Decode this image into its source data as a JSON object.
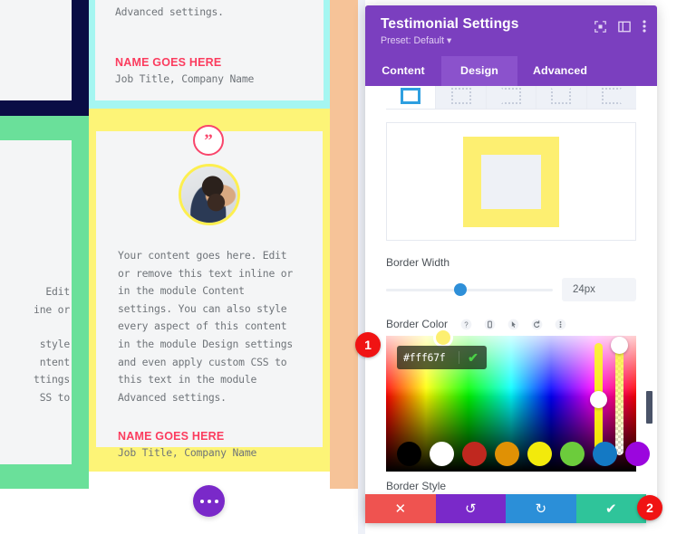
{
  "canvas": {
    "top_card": {
      "body_tail": "Advanced settings.",
      "name": "NAME GOES HERE",
      "job": "Job Title, Company Name"
    },
    "main_card": {
      "quote_glyph": "”",
      "body": "Your content goes here. Edit or remove this text inline or in the module Content settings. You can also style every aspect of this content in the module Design settings and even apply custom CSS to this text in the module Advanced settings.",
      "name": "NAME GOES HERE",
      "job": "Job Title, Company Name"
    },
    "left_card": {
      "line1": " Edit",
      "line2": "ine or",
      "line3": "style",
      "line4": "ntent",
      "line5": "ttings",
      "line6": "SS to"
    },
    "colors": {
      "navy": "#0a0d45",
      "cyan": "#a5f6f1",
      "green": "#6ae09a",
      "yellow": "#fdf477",
      "peach": "#f6c398",
      "card": "#f4f5f6",
      "accent_pink": "#fb3c5e",
      "avatar_ring": "#fdef4f"
    },
    "more_button_label": "…"
  },
  "panel": {
    "title": "Testimonial Settings",
    "preset": "Preset: Default ▾",
    "header_icons": [
      {
        "name": "focus-icon",
        "glyph": "⬚"
      },
      {
        "name": "layout-icon",
        "glyph": "▣"
      },
      {
        "name": "kebab-menu-icon",
        "glyph": "⋮"
      }
    ],
    "tabs": [
      {
        "label": "Content",
        "active": false
      },
      {
        "label": "Design",
        "active": true
      },
      {
        "label": "Advanced",
        "active": false
      }
    ],
    "border_presets": [
      {
        "name": "border-all",
        "selected": true
      },
      {
        "name": "border-top",
        "selected": false
      },
      {
        "name": "border-right",
        "selected": false
      },
      {
        "name": "border-bottom",
        "selected": false
      },
      {
        "name": "border-left",
        "selected": false
      }
    ],
    "preview": {
      "border_color": "#fdef71",
      "inner_color": "#eef1f6"
    },
    "border_width": {
      "label": "Border Width",
      "value": "24px",
      "slider_percent": 43
    },
    "border_color": {
      "label": "Border Color",
      "row_icons": [
        {
          "name": "help-icon",
          "glyph": "?"
        },
        {
          "name": "responsive-device-icon",
          "glyph": "▯"
        },
        {
          "name": "hover-cursor-icon",
          "glyph": "➤"
        },
        {
          "name": "reset-icon",
          "glyph": "↺"
        },
        {
          "name": "kebab-menu-icon",
          "glyph": "⋮"
        }
      ],
      "hex_value": "#fff67f",
      "confirm_glyph": "✔",
      "swatches": [
        "#000000",
        "#ffffff",
        "#c0281f",
        "#e09105",
        "#f2ea0c",
        "#6ccc3c",
        "#1479c4",
        "#9b06de"
      ]
    },
    "border_style": {
      "label": "Border Style"
    }
  },
  "actionbar": [
    {
      "name": "cancel-button",
      "glyph": "✕",
      "color": "#ef5350"
    },
    {
      "name": "undo-button",
      "glyph": "↺",
      "color": "#7a29c9"
    },
    {
      "name": "redo-button",
      "glyph": "↻",
      "color": "#2b8fd8"
    },
    {
      "name": "save-button",
      "glyph": "✔",
      "color": "#2fc49a"
    }
  ],
  "markers": [
    {
      "label": "1"
    },
    {
      "label": "2"
    }
  ]
}
